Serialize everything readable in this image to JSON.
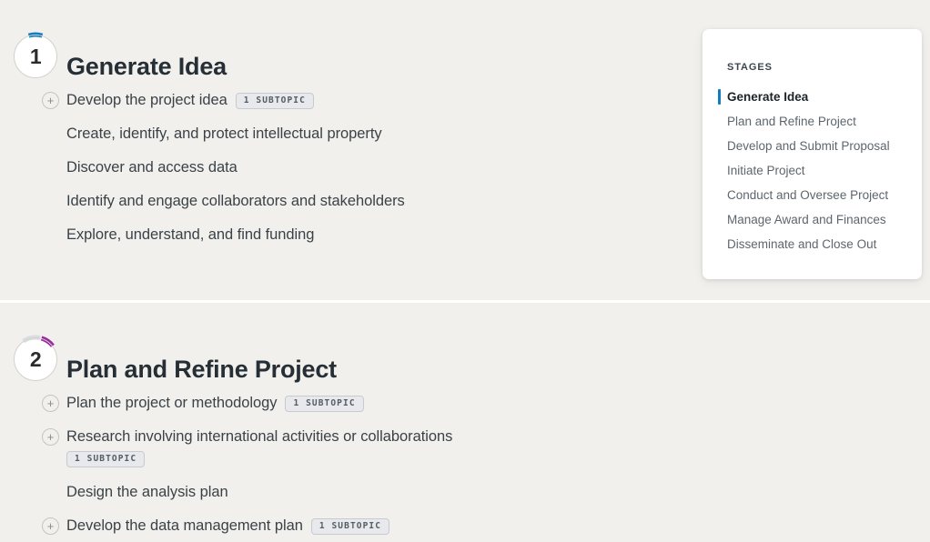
{
  "theme": {
    "page_bg": "#f1f0ed",
    "card_bg": "#ffffff",
    "accent_blue": "#0f7dc2",
    "accent_purple": "#9c27a0",
    "ring_gray": "#d2d0cd",
    "heading_color": "#262f36",
    "row_color": "#3a4248",
    "muted_color": "#5d666d",
    "pill_bg": "#e7e9ec",
    "pill_border": "#c7cbd0",
    "pill_text": "#555d64",
    "divider": "#ffffff"
  },
  "stages": [
    {
      "number": "1",
      "title": "Generate Idea",
      "progress_arc": {
        "color": "#0f7dc2",
        "start_deg": -18,
        "end_deg": 18
      },
      "secondary_arc": null,
      "topics": [
        {
          "label": "Develop the project idea",
          "expandable": true,
          "pill": "1 SUBTOPIC",
          "pill_wraps": false
        },
        {
          "label": "Create, identify, and protect intellectual property",
          "expandable": false,
          "pill": null,
          "pill_wraps": false
        },
        {
          "label": "Discover and access data",
          "expandable": false,
          "pill": null,
          "pill_wraps": false
        },
        {
          "label": "Identify and engage collaborators and stakeholders",
          "expandable": false,
          "pill": null,
          "pill_wraps": false
        },
        {
          "label": "Explore, understand, and find funding",
          "expandable": false,
          "pill": null,
          "pill_wraps": false
        }
      ]
    },
    {
      "number": "2",
      "title": "Plan and Refine Project",
      "progress_arc": {
        "color": "#9c27a0",
        "start_deg": 16,
        "end_deg": 52
      },
      "secondary_arc": {
        "color": "#dcdde2",
        "start_deg": -34,
        "end_deg": 12
      },
      "topics": [
        {
          "label": "Plan the project or methodology",
          "expandable": true,
          "pill": "1 SUBTOPIC",
          "pill_wraps": false
        },
        {
          "label": "Research involving international activities or collaborations",
          "expandable": true,
          "pill": "1 SUBTOPIC",
          "pill_wraps": true
        },
        {
          "label": "Design the analysis plan",
          "expandable": false,
          "pill": null,
          "pill_wraps": false
        },
        {
          "label": "Develop the data management plan",
          "expandable": true,
          "pill": "1 SUBTOPIC",
          "pill_wraps": false
        }
      ]
    }
  ],
  "sidebar": {
    "title": "STAGES",
    "items": [
      {
        "label": "Generate Idea",
        "active": true
      },
      {
        "label": "Plan and Refine Project",
        "active": false
      },
      {
        "label": "Develop and Submit Proposal",
        "active": false
      },
      {
        "label": "Initiate Project",
        "active": false
      },
      {
        "label": "Conduct and Oversee Project",
        "active": false
      },
      {
        "label": "Manage Award and Finances",
        "active": false
      },
      {
        "label": "Disseminate and Close Out",
        "active": false
      }
    ]
  },
  "icons": {
    "expand_plus": "+"
  }
}
